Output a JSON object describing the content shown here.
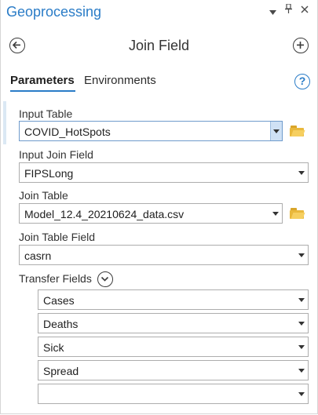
{
  "pane": {
    "title": "Geoprocessing",
    "menu_icon": "chevron-down-menu-icon",
    "pin_icon": "pin-icon",
    "close_icon": "close-icon"
  },
  "tool": {
    "title": "Join Field",
    "back_icon": "back-arrow-icon",
    "add_icon": "add-icon"
  },
  "tabs": [
    {
      "label": "Parameters",
      "active": true
    },
    {
      "label": "Environments",
      "active": false
    }
  ],
  "help": {
    "icon": "help-icon",
    "glyph": "?"
  },
  "params": {
    "input_table": {
      "label": "Input Table",
      "value": "COVID_HotSpots"
    },
    "input_join_field": {
      "label": "Input Join Field",
      "value": "FIPSLong"
    },
    "join_table": {
      "label": "Join Table",
      "value": "Model_12.4_20210624_data.csv"
    },
    "join_table_field": {
      "label": "Join Table Field",
      "value": "casrn"
    },
    "transfer_fields": {
      "label": "Transfer Fields",
      "items": [
        "Cases",
        "Deaths",
        "Sick",
        "Spread",
        ""
      ]
    }
  },
  "colors": {
    "accent": "#2a7cc7",
    "folder": "#e9b83c",
    "active_dropdown": "#cfe1f5"
  }
}
